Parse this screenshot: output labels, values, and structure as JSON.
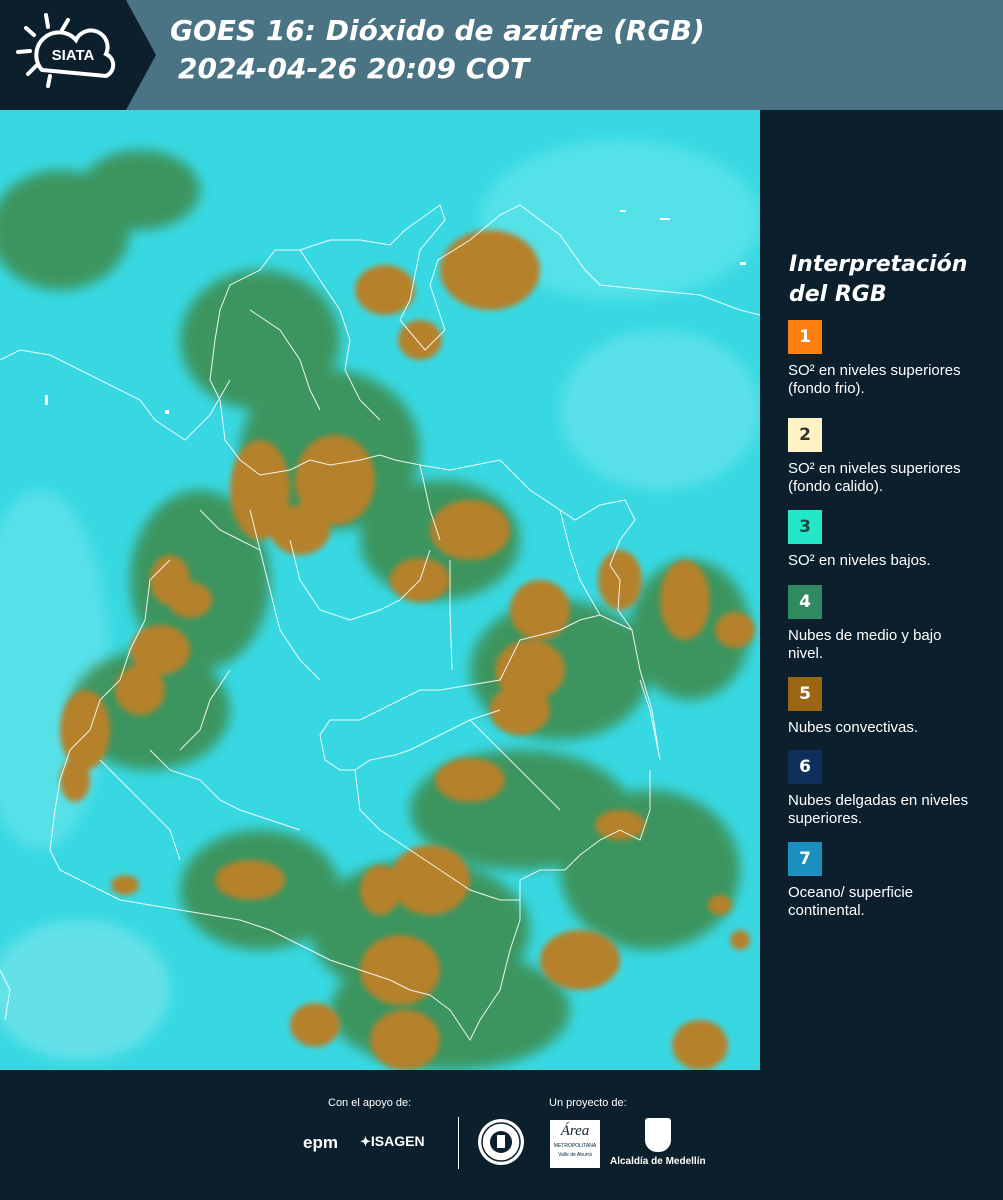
{
  "header": {
    "logo_text": "SIATA",
    "title_line1": "GOES 16: Dióxido de azúfre (RGB)",
    "title_line2": "2024-04-26 20:09 COT",
    "background_color": "#4a7484"
  },
  "legend": {
    "title": "Interpretación del RGB",
    "items": [
      {
        "number": "1",
        "color": "#ff7f0e",
        "text": "SO² en niveles superiores (fondo frio)."
      },
      {
        "number": "2",
        "color": "#fff3c4",
        "text": "SO² en niveles superiores (fondo calido)."
      },
      {
        "number": "3",
        "color": "#22e8c8",
        "text": "SO² en niveles bajos."
      },
      {
        "number": "4",
        "color": "#2f8a62",
        "text": "Nubes de medio y bajo nivel."
      },
      {
        "number": "5",
        "color": "#9c6512",
        "text": "Nubes convectivas."
      },
      {
        "number": "6",
        "color": "#0e2f5c",
        "text": "Nubes delgadas en niveles superiores."
      },
      {
        "number": "7",
        "color": "#1b8fbf",
        "text": "Oceano/ superficie continental."
      }
    ]
  },
  "footer": {
    "support_label": "Con el apoyo de:",
    "project_label": "Un proyecto de:",
    "sponsor_epm": "epm",
    "sponsor_isagen": "ISAGEN",
    "partner_area_main": "Área",
    "partner_area_sub1": "METROPOLITANA",
    "partner_area_sub2": "Valle de Aburrá",
    "partner_alcaldia": "Alcaldía de Medellín"
  },
  "map": {
    "ocean_color": "#35d6e0",
    "convective_color": "#b0802c",
    "low_cloud_color": "#3f8a4a"
  }
}
